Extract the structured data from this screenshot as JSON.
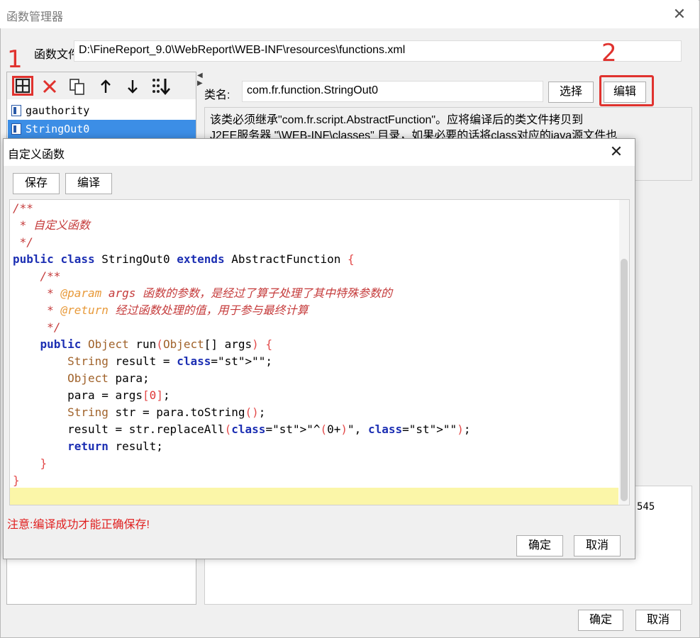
{
  "outer_window": {
    "title": "函数管理器",
    "file_label": "函数文件:",
    "file_path": "D:\\FineReport_9.0\\WebReport\\WEB-INF\\resources\\functions.xml",
    "toolbar_icons": [
      "add-icon",
      "delete-icon",
      "copy-icon",
      "move-up-icon",
      "move-down-icon",
      "sort-icon"
    ],
    "function_list": [
      "gauthority",
      "StringOut0"
    ],
    "class_label": "类名:",
    "class_value": "com.fr.function.StringOut0",
    "select_label": "选择",
    "edit_label": "编辑",
    "description_line1": "该类必须继承\"com.fr.script.AbstractFunction\"。应将编译后的类文件拷贝到",
    "description_line2": "J2EE服务器 \"\\WEB-INF\\classes\" 目录，如果必要的话将class对应的java源文件也",
    "right_panel_number": "545",
    "ok_label": "确定",
    "cancel_label": "取消"
  },
  "annotations": {
    "step1": "1",
    "step2": "2",
    "accent_color": "#e0322e"
  },
  "inner_dialog": {
    "title": "自定义函数",
    "save_label": "保存",
    "compile_label": "编译",
    "notice": "注意:编译成功才能正确保存!",
    "ok_label": "确定",
    "cancel_label": "取消",
    "code_lines": [
      "/**",
      " * 自定义函数",
      " */",
      "public class StringOut0 extends AbstractFunction {",
      "    /**",
      "     * @param args 函数的参数，是经过了算子处理了其中特殊参数的",
      "     * @return 经过函数处理的值，用于参与最终计算",
      "     */",
      "    public Object run(Object[] args) {",
      "        String result = \"\";",
      "        Object para;",
      "        para = args[0];",
      "        String str = para.toString();",
      "        result = str.replaceAll(\"^(0+)\", \"\");",
      "        return result;",
      "    }",
      "}"
    ]
  }
}
